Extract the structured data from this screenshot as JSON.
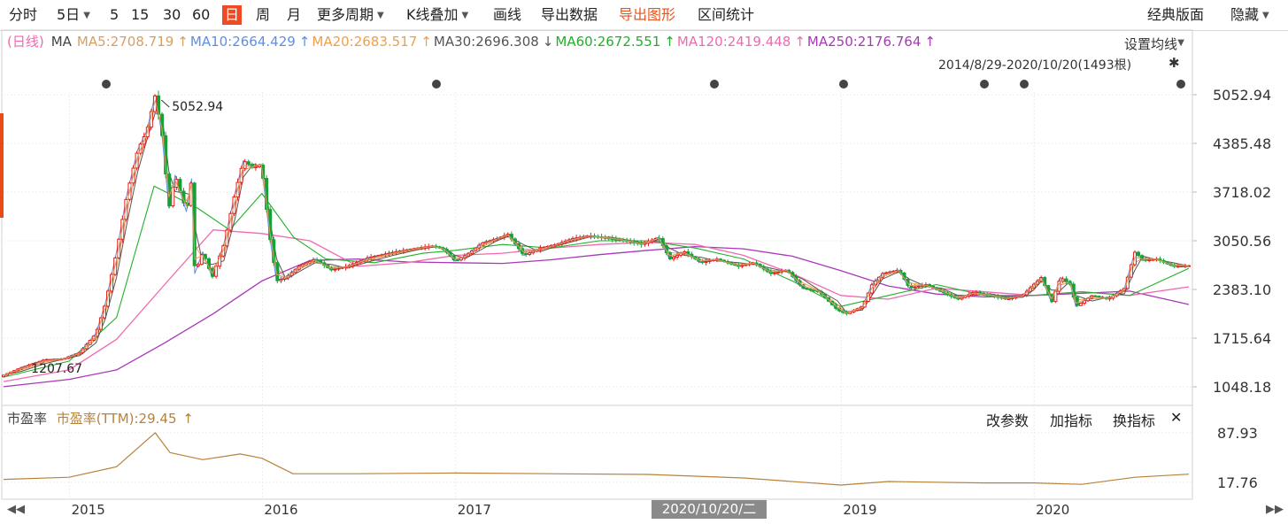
{
  "toolbar": {
    "items": [
      {
        "label": "分时",
        "x": 10
      },
      {
        "label": "5日",
        "x": 64,
        "caret": true
      },
      {
        "label": "5",
        "x": 124
      },
      {
        "label": "15",
        "x": 148
      },
      {
        "label": "30",
        "x": 184
      },
      {
        "label": "60",
        "x": 217
      },
      {
        "label": "日",
        "x": 251,
        "active": true
      },
      {
        "label": "周",
        "x": 289
      },
      {
        "label": "月",
        "x": 324
      },
      {
        "label": "更多周期",
        "x": 358,
        "caret": true
      },
      {
        "label": "K线叠加",
        "x": 459,
        "caret": true
      },
      {
        "label": "画线",
        "x": 557
      },
      {
        "label": "导出数据",
        "x": 611
      },
      {
        "label": "导出图形",
        "x": 699,
        "orange": true
      },
      {
        "label": "区间统计",
        "x": 788
      },
      {
        "label": "经典版面",
        "x": 1296
      },
      {
        "label": "隐藏",
        "x": 1390,
        "caret": true
      }
    ]
  },
  "ma_header": {
    "prefix": "(日线)",
    "label": "MA",
    "items": [
      {
        "text": "MA5:2708.719",
        "color": "#d7a062",
        "arrow": "↑"
      },
      {
        "text": "MA10:2664.429",
        "color": "#5e8ee8",
        "arrow": "↑"
      },
      {
        "text": "MA20:2683.517",
        "color": "#f0a04a",
        "arrow": "↑"
      },
      {
        "text": "MA30:2696.308",
        "color": "#555555",
        "arrow": "↓"
      },
      {
        "text": "MA60:2672.551",
        "color": "#22b02a",
        "arrow": "↑"
      },
      {
        "text": "MA120:2419.448",
        "color": "#f06ab0",
        "arrow": "↑"
      },
      {
        "text": "MA250:2176.764",
        "color": "#a838b8",
        "arrow": "↑"
      }
    ],
    "settings": "设置均线",
    "range": "2014/8/29-2020/10/20(1493根)",
    "pin": "✱"
  },
  "pe_panel": {
    "name": "市盈率",
    "value_text": "市盈率(TTM):29.45",
    "arrow": "↑",
    "buttons": [
      "改参数",
      "加指标",
      "换指标",
      "✕"
    ]
  },
  "x_axis": {
    "labels": [
      {
        "text": "2015",
        "date": "2015-01-01"
      },
      {
        "text": "2016",
        "date": "2016-01-01"
      },
      {
        "text": "2017",
        "date": "2017-01-01"
      },
      {
        "text": "2019",
        "date": "2019-01-01"
      },
      {
        "text": "2020",
        "date": "2020-01-01"
      }
    ],
    "cursor_date": "2020/10/20/二"
  },
  "chart_data": {
    "type": "line",
    "x_range": [
      "2014-08-29",
      "2020-10-20"
    ],
    "price": {
      "yticks": [
        5052.94,
        4385.48,
        3718.02,
        3050.56,
        2383.1,
        1715.64,
        1048.18
      ],
      "ylim": [
        830,
        5350
      ],
      "annotations": [
        {
          "text": "5052.94",
          "date": "2015-06-12",
          "value": 5052.94
        },
        {
          "text": "1207.67",
          "date": "2014-09-05",
          "value": 1207.67
        }
      ],
      "close": [
        [
          "2014-08-29",
          1207.67
        ],
        [
          "2014-10-01",
          1310
        ],
        [
          "2014-11-15",
          1420
        ],
        [
          "2014-12-20",
          1430
        ],
        [
          "2015-01-20",
          1520
        ],
        [
          "2015-02-20",
          1780
        ],
        [
          "2015-03-10",
          2200
        ],
        [
          "2015-03-31",
          2900
        ],
        [
          "2015-04-20",
          3700
        ],
        [
          "2015-05-10",
          4300
        ],
        [
          "2015-05-27",
          4550
        ],
        [
          "2015-06-12",
          5052.94
        ],
        [
          "2015-06-25",
          4500
        ],
        [
          "2015-07-08",
          3500
        ],
        [
          "2015-07-20",
          3950
        ],
        [
          "2015-08-10",
          3450
        ],
        [
          "2015-08-20",
          3900
        ],
        [
          "2015-08-26",
          2600
        ],
        [
          "2015-09-10",
          2900
        ],
        [
          "2015-09-28",
          2550
        ],
        [
          "2015-10-20",
          3000
        ],
        [
          "2015-11-10",
          3700
        ],
        [
          "2015-11-26",
          4150
        ],
        [
          "2015-12-15",
          4050
        ],
        [
          "2015-12-30",
          4100
        ],
        [
          "2016-01-07",
          3600
        ],
        [
          "2016-01-15",
          3100
        ],
        [
          "2016-01-28",
          2500
        ],
        [
          "2016-02-15",
          2550
        ],
        [
          "2016-03-10",
          2700
        ],
        [
          "2016-04-10",
          2800
        ],
        [
          "2016-05-10",
          2650
        ],
        [
          "2016-06-10",
          2700
        ],
        [
          "2016-07-20",
          2820
        ],
        [
          "2016-09-10",
          2900
        ],
        [
          "2016-10-20",
          2950
        ],
        [
          "2016-11-20",
          2980
        ],
        [
          "2016-12-10",
          2930
        ],
        [
          "2016-12-31",
          2770
        ],
        [
          "2017-01-20",
          2850
        ],
        [
          "2017-02-20",
          3020
        ],
        [
          "2017-03-20",
          3080
        ],
        [
          "2017-04-10",
          3140
        ],
        [
          "2017-05-10",
          2850
        ],
        [
          "2017-06-10",
          2950
        ],
        [
          "2017-07-10",
          3000
        ],
        [
          "2017-08-10",
          3080
        ],
        [
          "2017-09-10",
          3120
        ],
        [
          "2017-10-20",
          3080
        ],
        [
          "2017-11-20",
          3050
        ],
        [
          "2017-12-20",
          3000
        ],
        [
          "2018-01-20",
          3100
        ],
        [
          "2018-02-10",
          2800
        ],
        [
          "2018-03-10",
          2900
        ],
        [
          "2018-04-10",
          2750
        ],
        [
          "2018-05-10",
          2800
        ],
        [
          "2018-06-20",
          2700
        ],
        [
          "2018-07-20",
          2750
        ],
        [
          "2018-08-20",
          2600
        ],
        [
          "2018-09-20",
          2650
        ],
        [
          "2018-10-20",
          2400
        ],
        [
          "2018-11-20",
          2350
        ],
        [
          "2018-12-25",
          2100
        ],
        [
          "2019-01-10",
          2050
        ],
        [
          "2019-02-10",
          2150
        ],
        [
          "2019-02-28",
          2450
        ],
        [
          "2019-03-20",
          2600
        ],
        [
          "2019-04-20",
          2650
        ],
        [
          "2019-05-10",
          2400
        ],
        [
          "2019-06-10",
          2450
        ],
        [
          "2019-07-10",
          2350
        ],
        [
          "2019-08-10",
          2250
        ],
        [
          "2019-09-10",
          2350
        ],
        [
          "2019-10-10",
          2300
        ],
        [
          "2019-11-10",
          2250
        ],
        [
          "2019-12-10",
          2300
        ],
        [
          "2019-12-31",
          2450
        ],
        [
          "2020-01-15",
          2550
        ],
        [
          "2020-02-03",
          2200
        ],
        [
          "2020-02-20",
          2550
        ],
        [
          "2020-03-10",
          2450
        ],
        [
          "2020-03-20",
          2150
        ],
        [
          "2020-04-20",
          2300
        ],
        [
          "2020-05-20",
          2250
        ],
        [
          "2020-06-20",
          2400
        ],
        [
          "2020-07-10",
          2900
        ],
        [
          "2020-07-25",
          2780
        ],
        [
          "2020-08-20",
          2800
        ],
        [
          "2020-09-20",
          2700
        ],
        [
          "2020-10-20",
          2708.72
        ]
      ],
      "ma250": [
        [
          "2014-08-29",
          1050
        ],
        [
          "2014-12-31",
          1150
        ],
        [
          "2015-03-31",
          1280
        ],
        [
          "2015-06-30",
          1650
        ],
        [
          "2015-09-30",
          2050
        ],
        [
          "2015-12-31",
          2500
        ],
        [
          "2016-03-31",
          2780
        ],
        [
          "2016-06-30",
          2800
        ],
        [
          "2016-09-30",
          2760
        ],
        [
          "2016-12-31",
          2750
        ],
        [
          "2017-03-31",
          2740
        ],
        [
          "2017-06-30",
          2790
        ],
        [
          "2017-09-30",
          2860
        ],
        [
          "2017-12-31",
          2920
        ],
        [
          "2018-03-31",
          2970
        ],
        [
          "2018-06-30",
          2940
        ],
        [
          "2018-09-30",
          2840
        ],
        [
          "2018-12-31",
          2640
        ],
        [
          "2019-03-31",
          2430
        ],
        [
          "2019-06-30",
          2320
        ],
        [
          "2019-09-30",
          2280
        ],
        [
          "2019-12-31",
          2300
        ],
        [
          "2020-03-31",
          2330
        ],
        [
          "2020-06-30",
          2360
        ],
        [
          "2020-10-20",
          2176.76
        ]
      ],
      "ma120": [
        [
          "2014-08-29",
          1120
        ],
        [
          "2014-12-31",
          1280
        ],
        [
          "2015-03-31",
          1700
        ],
        [
          "2015-06-30",
          2450
        ],
        [
          "2015-09-30",
          3200
        ],
        [
          "2015-12-31",
          3150
        ],
        [
          "2016-03-31",
          3050
        ],
        [
          "2016-06-30",
          2700
        ],
        [
          "2016-09-30",
          2750
        ],
        [
          "2016-12-31",
          2850
        ],
        [
          "2017-03-31",
          2880
        ],
        [
          "2017-06-30",
          2950
        ],
        [
          "2017-09-30",
          3000
        ],
        [
          "2017-12-31",
          3030
        ],
        [
          "2018-03-31",
          3000
        ],
        [
          "2018-06-30",
          2850
        ],
        [
          "2018-09-30",
          2600
        ],
        [
          "2018-12-31",
          2300
        ],
        [
          "2019-03-31",
          2250
        ],
        [
          "2019-06-30",
          2400
        ],
        [
          "2019-09-30",
          2350
        ],
        [
          "2019-12-31",
          2300
        ],
        [
          "2020-03-31",
          2350
        ],
        [
          "2020-06-30",
          2300
        ],
        [
          "2020-10-20",
          2419.45
        ]
      ],
      "ma60": [
        [
          "2014-08-29",
          1180
        ],
        [
          "2014-12-31",
          1400
        ],
        [
          "2015-03-31",
          2000
        ],
        [
          "2015-06-10",
          3800
        ],
        [
          "2015-08-31",
          3500
        ],
        [
          "2015-10-31",
          3200
        ],
        [
          "2015-12-31",
          3700
        ],
        [
          "2016-02-29",
          3100
        ],
        [
          "2016-04-30",
          2800
        ],
        [
          "2016-07-31",
          2750
        ],
        [
          "2016-10-31",
          2880
        ],
        [
          "2016-12-31",
          2920
        ],
        [
          "2017-03-31",
          3000
        ],
        [
          "2017-06-30",
          2950
        ],
        [
          "2017-09-30",
          3050
        ],
        [
          "2017-12-31",
          3050
        ],
        [
          "2018-03-31",
          2950
        ],
        [
          "2018-06-30",
          2800
        ],
        [
          "2018-09-30",
          2500
        ],
        [
          "2018-12-31",
          2150
        ],
        [
          "2019-03-31",
          2300
        ],
        [
          "2019-06-30",
          2450
        ],
        [
          "2019-09-30",
          2300
        ],
        [
          "2019-12-31",
          2300
        ],
        [
          "2020-03-31",
          2350
        ],
        [
          "2020-06-30",
          2300
        ],
        [
          "2020-10-20",
          2672.55
        ]
      ]
    },
    "pe": {
      "yticks": [
        87.93,
        17.76
      ],
      "ylim": [
        8,
        92
      ],
      "values": [
        [
          "2014-08-29",
          22
        ],
        [
          "2014-12-31",
          25
        ],
        [
          "2015-03-31",
          40
        ],
        [
          "2015-06-12",
          88
        ],
        [
          "2015-07-10",
          60
        ],
        [
          "2015-09-10",
          50
        ],
        [
          "2015-11-20",
          58
        ],
        [
          "2015-12-31",
          52
        ],
        [
          "2016-02-28",
          30
        ],
        [
          "2016-06-30",
          30
        ],
        [
          "2016-12-31",
          31
        ],
        [
          "2017-06-30",
          30
        ],
        [
          "2017-12-31",
          29
        ],
        [
          "2018-06-30",
          24
        ],
        [
          "2018-12-31",
          14
        ],
        [
          "2019-03-31",
          19
        ],
        [
          "2019-09-30",
          17
        ],
        [
          "2019-12-31",
          17
        ],
        [
          "2020-03-31",
          15
        ],
        [
          "2020-07-10",
          25
        ],
        [
          "2020-10-20",
          29.45
        ]
      ]
    }
  }
}
